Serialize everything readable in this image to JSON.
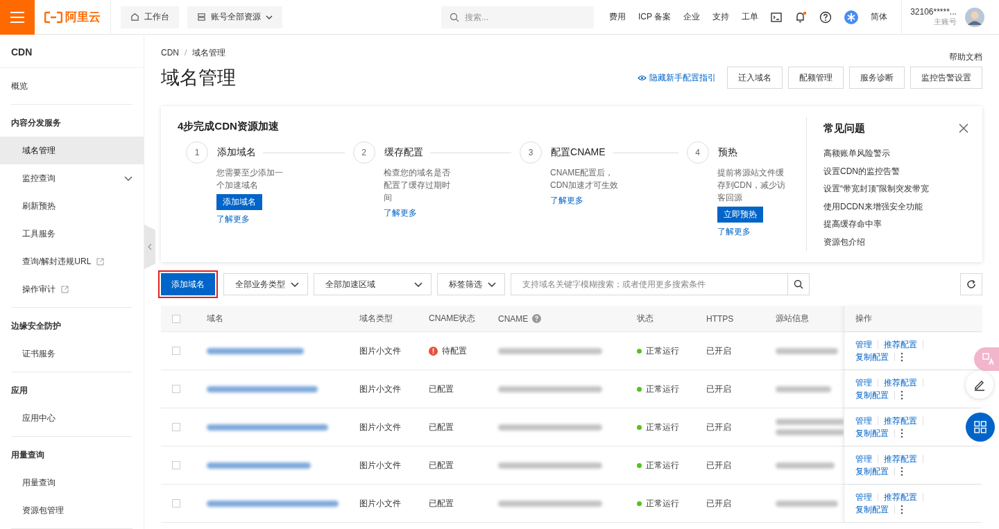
{
  "topbar": {
    "logo": "阿里云",
    "workbench": "工作台",
    "resources": "账号全部资源",
    "search": {
      "placeholder": "搜索..."
    },
    "links": [
      "费用",
      "ICP 备案",
      "企业",
      "支持",
      "工单"
    ],
    "bell_unread": true,
    "language": "简体",
    "user": {
      "name": "32106*****...",
      "role": "主账号"
    }
  },
  "sidebar": {
    "title": "CDN",
    "sections": [
      {
        "items": [
          {
            "label": "概览",
            "kind": "link",
            "selected": false
          }
        ]
      },
      {
        "heading": "内容分发服务",
        "items": [
          {
            "label": "域名管理",
            "kind": "link",
            "selected": true
          },
          {
            "label": "监控查询",
            "kind": "group",
            "selected": false
          },
          {
            "label": "刷新预热",
            "kind": "link",
            "selected": false
          },
          {
            "label": "工具服务",
            "kind": "link",
            "selected": false
          },
          {
            "label": "查询/解封违规URL",
            "kind": "external",
            "selected": false
          },
          {
            "label": "操作审计",
            "kind": "external",
            "selected": false
          }
        ]
      },
      {
        "heading": "边缘安全防护",
        "items": [
          {
            "label": "证书服务",
            "kind": "link",
            "selected": false
          }
        ]
      },
      {
        "heading": "应用",
        "items": [
          {
            "label": "应用中心",
            "kind": "link",
            "selected": false
          }
        ]
      },
      {
        "heading": "用量查询",
        "items": [
          {
            "label": "用量查询",
            "kind": "link",
            "selected": false
          },
          {
            "label": "资源包管理",
            "kind": "link",
            "selected": false
          }
        ]
      }
    ]
  },
  "breadcrumb": [
    "CDN",
    "域名管理"
  ],
  "breadcrumb_separator": "/",
  "help_link": "帮助文档",
  "page_title": "域名管理",
  "header_link": "隐藏新手配置指引",
  "header_buttons": [
    "迁入域名",
    "配额管理",
    "服务诊断",
    "监控告警设置"
  ],
  "guide": {
    "title": "4步完成CDN资源加速",
    "steps": [
      {
        "number": "1",
        "title": "添加域名",
        "description": "您需要至少添加一个加速域名",
        "button": "添加域名",
        "link": "了解更多"
      },
      {
        "number": "2",
        "title": "缓存配置",
        "description": "检查您的域名是否配置了缓存过期时间",
        "link": "了解更多"
      },
      {
        "number": "3",
        "title": "配置CNAME",
        "description": "CNAME配置后，CDN加速才可生效",
        "link": "了解更多"
      },
      {
        "number": "4",
        "title": "预热",
        "description": "提前将源站文件缓存到CDN，减少访客回源",
        "button": "立即预热",
        "link": "了解更多"
      }
    ],
    "faq_title": "常见问题",
    "faq": [
      "高额账单风险警示",
      "设置CDN的监控告警",
      "设置“带宽封顶”限制突发带宽",
      "使用DCDN来增强安全功能",
      "提高缓存命中率",
      "资源包介绍"
    ]
  },
  "toolbar": {
    "add_button": "添加域名",
    "highlighted": true,
    "filters": [
      {
        "label": "全部业务类型",
        "kind": "compact"
      },
      {
        "label": "全部加速区域",
        "kind": "wide"
      },
      {
        "label": "标签筛选",
        "kind": "compact"
      }
    ],
    "search": {
      "placeholder": "支持域名关键字模糊搜索；或者使用更多搜索条件"
    }
  },
  "table": {
    "select_all": {
      "checked": false
    },
    "columns": [
      "域名",
      "域名类型",
      "CNAME状态",
      "CNAME",
      "状态",
      "HTTPS",
      "源站信息",
      "操作"
    ],
    "rows": [
      {
        "checked": false,
        "type": "图片小文件",
        "cname_status": {
          "text": "待配置",
          "warning": true
        },
        "status": "正常运行",
        "https": "已开启",
        "actions": [
          "管理",
          "推荐配置",
          "复制配置"
        ]
      },
      {
        "checked": false,
        "type": "图片小文件",
        "cname_status": {
          "text": "已配置",
          "warning": false
        },
        "status": "正常运行",
        "https": "已开启",
        "actions": [
          "管理",
          "推荐配置",
          "复制配置"
        ]
      },
      {
        "checked": false,
        "type": "图片小文件",
        "cname_status": {
          "text": "已配置",
          "warning": false
        },
        "status": "正常运行",
        "https": "已开启",
        "actions": [
          "管理",
          "推荐配置",
          "复制配置"
        ]
      },
      {
        "checked": false,
        "type": "图片小文件",
        "cname_status": {
          "text": "已配置",
          "warning": false
        },
        "status": "正常运行",
        "https": "已开启",
        "actions": [
          "管理",
          "推荐配置",
          "复制配置"
        ]
      },
      {
        "checked": false,
        "type": "图片小文件",
        "cname_status": {
          "text": "已配置",
          "warning": false
        },
        "status": "正常运行",
        "https": "已开启",
        "actions": [
          "管理",
          "推荐配置",
          "复制配置"
        ]
      }
    ]
  }
}
